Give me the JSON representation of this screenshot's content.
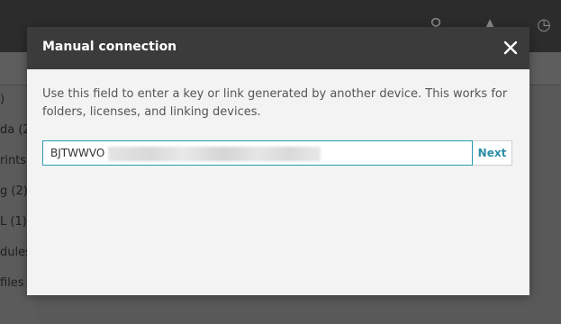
{
  "background": {
    "sidebar_items": [
      ")",
      "da (2",
      "rints",
      "g (2)",
      "L (1)",
      "dules",
      "files"
    ]
  },
  "dialog": {
    "title": "Manual connection",
    "description": "Use this field to enter a key or link generated by another device. This works for folders, licenses, and linking devices.",
    "input_value": "BJTWWVO",
    "next_label": "Next"
  },
  "colors": {
    "accent": "#2a9bb0",
    "header": "#3b3b3b",
    "dialog_bg": "#f3f3f3"
  }
}
